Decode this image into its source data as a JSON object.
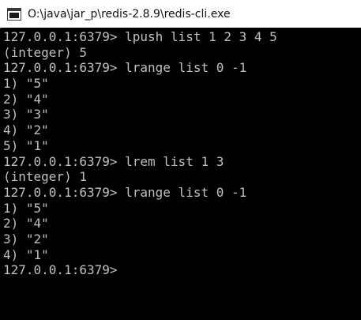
{
  "window": {
    "title": "O:\\java\\jar_p\\redis-2.8.9\\redis-cli.exe",
    "icon": "console-app-icon"
  },
  "console": {
    "lines": [
      "127.0.0.1:6379> lpush list 1 2 3 4 5",
      "(integer) 5",
      "127.0.0.1:6379> lrange list 0 -1",
      "1) \"5\"",
      "2) \"4\"",
      "3) \"3\"",
      "4) \"2\"",
      "5) \"1\"",
      "127.0.0.1:6379> lrem list 1 3",
      "(integer) 1",
      "127.0.0.1:6379> lrange list 0 -1",
      "1) \"5\"",
      "2) \"4\"",
      "3) \"2\"",
      "4) \"1\"",
      "127.0.0.1:6379>"
    ]
  },
  "colors": {
    "background": "#000000",
    "text": "#c0c0c0",
    "titlebar": "#ffffff"
  }
}
